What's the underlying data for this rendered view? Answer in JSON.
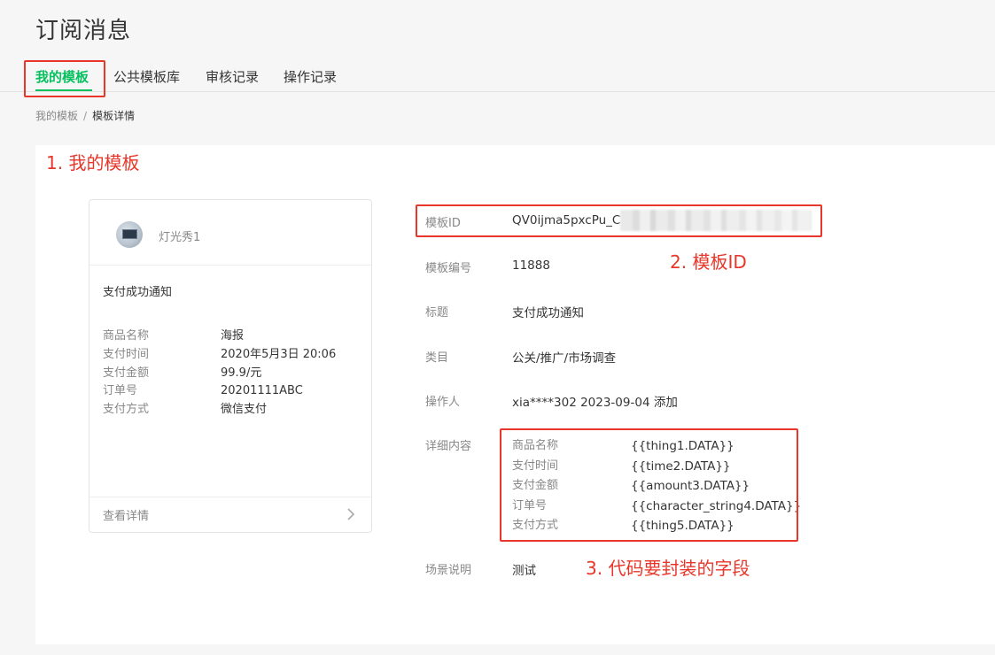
{
  "page": {
    "title": "订阅消息"
  },
  "tabs": [
    {
      "label": "我的模板"
    },
    {
      "label": "公共模板库"
    },
    {
      "label": "审核记录"
    },
    {
      "label": "操作记录"
    }
  ],
  "breadcrumb": {
    "parent": "我的模板",
    "separator": "/",
    "current": "模板详情"
  },
  "annotations": {
    "my_template": "1. 我的模板",
    "template_id": "2. 模板ID",
    "fields": "3. 代码要封装的字段"
  },
  "preview_card": {
    "account_name": "灯光秀1",
    "title": "支付成功通知",
    "rows": [
      {
        "key": "商品名称",
        "value": "海报"
      },
      {
        "key": "支付时间",
        "value": "2020年5月3日 20:06"
      },
      {
        "key": "支付金额",
        "value": "99.9/元"
      },
      {
        "key": "订单号",
        "value": "20201111ABC"
      },
      {
        "key": "支付方式",
        "value": "微信支付"
      }
    ],
    "footer_label": "查看详情",
    "footer_icon": "chevron-right-icon"
  },
  "template_info": {
    "id_label": "模板ID",
    "id_value": "QV0ijma5pxcPu_C",
    "number_label": "模板编号",
    "number_value": "11888",
    "title_label": "标题",
    "title_value": "支付成功通知",
    "category_label": "类目",
    "category_value": "公关/推广/市场调查",
    "operator_label": "操作人",
    "operator_value": "xia****302 2023-09-04 添加",
    "detail_label": "详细内容",
    "detail_rows": [
      {
        "key": "商品名称",
        "value": "{{thing1.DATA}}"
      },
      {
        "key": "支付时间",
        "value": "{{time2.DATA}}"
      },
      {
        "key": "支付金额",
        "value": "{{amount3.DATA}}"
      },
      {
        "key": "订单号",
        "value": "{{character_string4.DATA}}"
      },
      {
        "key": "支付方式",
        "value": "{{thing5.DATA}}"
      }
    ],
    "scene_label": "场景说明",
    "scene_value": "测试"
  },
  "colors": {
    "accent": "#07c160",
    "highlight": "#e8362a",
    "muted": "#888888",
    "text": "#353535"
  }
}
